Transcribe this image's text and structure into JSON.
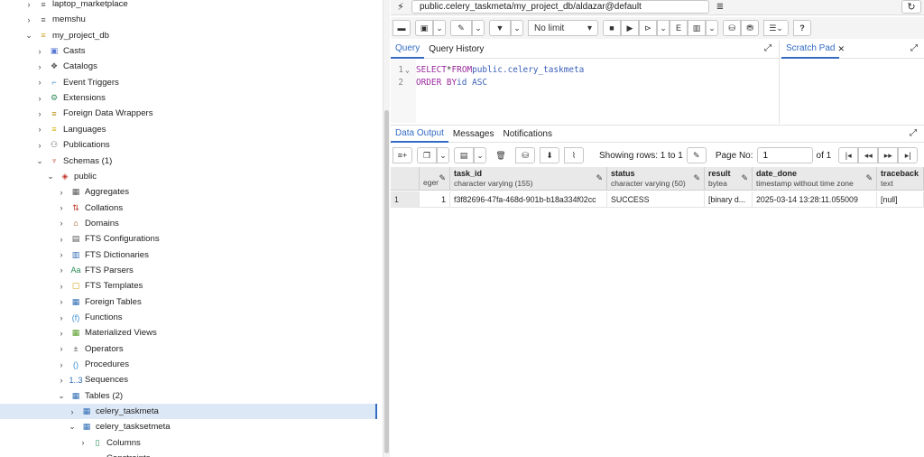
{
  "tree": {
    "nodes": [
      {
        "label": "laptop_marketplace",
        "chev": "›",
        "icon": "database-icon",
        "glyph": "≡",
        "color": "#555",
        "level": 0
      },
      {
        "label": "memshu",
        "chev": "›",
        "icon": "database-icon",
        "glyph": "≡",
        "color": "#555",
        "level": 0
      },
      {
        "label": "my_project_db",
        "chev": "⌄",
        "icon": "database-icon",
        "glyph": "≡",
        "color": "#c9a227",
        "level": 0
      },
      {
        "label": "Casts",
        "chev": "›",
        "icon": "casts-icon",
        "glyph": "▣",
        "color": "#5b7bd5",
        "level": 1
      },
      {
        "label": "Catalogs",
        "chev": "›",
        "icon": "catalogs-icon",
        "glyph": "❖",
        "color": "#555",
        "level": 1
      },
      {
        "label": "Event Triggers",
        "chev": "›",
        "icon": "event-triggers-icon",
        "glyph": "⌐",
        "color": "#3a8dd1",
        "level": 1
      },
      {
        "label": "Extensions",
        "chev": "›",
        "icon": "extensions-icon",
        "glyph": "⚙",
        "color": "#2e8b57",
        "level": 1
      },
      {
        "label": "Foreign Data Wrappers",
        "chev": "›",
        "icon": "foreign-data-wrappers-icon",
        "glyph": "≡",
        "color": "#b8860b",
        "level": 1
      },
      {
        "label": "Languages",
        "chev": "›",
        "icon": "languages-icon",
        "glyph": "≡",
        "color": "#d4b106",
        "level": 1
      },
      {
        "label": "Publications",
        "chev": "›",
        "icon": "publications-icon",
        "glyph": "⚇",
        "color": "#666",
        "level": 1
      },
      {
        "label": "Schemas (1)",
        "chev": "⌄",
        "icon": "schemas-icon",
        "glyph": "♆",
        "color": "#c0392b",
        "level": 1
      },
      {
        "label": "public",
        "chev": "⌄",
        "icon": "schema-icon",
        "glyph": "◈",
        "color": "#c0392b",
        "level": 2
      },
      {
        "label": "Aggregates",
        "chev": "›",
        "icon": "aggregates-icon",
        "glyph": "▦",
        "color": "#555",
        "level": 3
      },
      {
        "label": "Collations",
        "chev": "›",
        "icon": "collations-icon",
        "glyph": "⇅",
        "color": "#c0392b",
        "level": 3
      },
      {
        "label": "Domains",
        "chev": "›",
        "icon": "domains-icon",
        "glyph": "⌂",
        "color": "#8b4513",
        "level": 3
      },
      {
        "label": "FTS Configurations",
        "chev": "›",
        "icon": "fts-configurations-icon",
        "glyph": "▤",
        "color": "#555",
        "level": 3
      },
      {
        "label": "FTS Dictionaries",
        "chev": "›",
        "icon": "fts-dictionaries-icon",
        "glyph": "▥",
        "color": "#2e6db4",
        "level": 3
      },
      {
        "label": "FTS Parsers",
        "chev": "›",
        "icon": "fts-parsers-icon",
        "glyph": "Aa",
        "color": "#2e8b57",
        "level": 3
      },
      {
        "label": "FTS Templates",
        "chev": "›",
        "icon": "fts-templates-icon",
        "glyph": "▢",
        "color": "#d4a017",
        "level": 3
      },
      {
        "label": "Foreign Tables",
        "chev": "›",
        "icon": "foreign-tables-icon",
        "glyph": "▦",
        "color": "#2e6db4",
        "level": 3
      },
      {
        "label": "Functions",
        "chev": "›",
        "icon": "functions-icon",
        "glyph": "(f)",
        "color": "#3a8dd1",
        "level": 3
      },
      {
        "label": "Materialized Views",
        "chev": "›",
        "icon": "materialized-views-icon",
        "glyph": "▦",
        "color": "#5aa02c",
        "level": 3
      },
      {
        "label": "Operators",
        "chev": "›",
        "icon": "operators-icon",
        "glyph": "±",
        "color": "#555",
        "level": 3
      },
      {
        "label": "Procedures",
        "chev": "›",
        "icon": "procedures-icon",
        "glyph": "()",
        "color": "#3a8dd1",
        "level": 3
      },
      {
        "label": "Sequences",
        "chev": "›",
        "icon": "sequences-icon",
        "glyph": "1..3",
        "color": "#2e6db4",
        "level": 3
      },
      {
        "label": "Tables (2)",
        "chev": "⌄",
        "icon": "tables-icon",
        "glyph": "▦",
        "color": "#2e6db4",
        "level": 3
      },
      {
        "label": "celery_taskmeta",
        "chev": "›",
        "icon": "table-icon",
        "glyph": "▦",
        "color": "#2e6db4",
        "level": 4,
        "selected": true
      },
      {
        "label": "celery_tasksetmeta",
        "chev": "⌄",
        "icon": "table-icon",
        "glyph": "▦",
        "color": "#2e6db4",
        "level": 4
      },
      {
        "label": "Columns",
        "chev": "›",
        "icon": "columns-icon",
        "glyph": "▯",
        "color": "#2e8b57",
        "level": 5
      },
      {
        "label": "Constraints",
        "chev": "›",
        "icon": "constraints-icon",
        "glyph": "",
        "color": "#555",
        "level": 5
      }
    ]
  },
  "connection": {
    "title": "public.celery_taskmeta/my_project_db/aldazar@default"
  },
  "toolbar": {
    "limit": "No limit"
  },
  "editor": {
    "tab_query": "Query",
    "tab_history": "Query History",
    "lines": [
      {
        "num": "1",
        "kw1": "SELECT",
        "op": " * ",
        "kw2": "FROM",
        "rest": " public.celery_taskmeta"
      },
      {
        "num": "2",
        "kw1": "ORDER BY",
        "op": " ",
        "kw2": "",
        "rest": "id ASC"
      }
    ]
  },
  "scratch": {
    "label": "Scratch Pad",
    "close": "✕"
  },
  "output": {
    "tab_data": "Data Output",
    "tab_messages": "Messages",
    "tab_notifications": "Notifications",
    "showing": "Showing rows: 1 to 1",
    "page_label": "Page No:",
    "page_value": "1",
    "page_of": "of 1"
  },
  "grid": {
    "columns": [
      {
        "name": "",
        "type": "eger",
        "pen": true
      },
      {
        "name": "task_id",
        "type": "character varying (155)",
        "pen": true
      },
      {
        "name": "status",
        "type": "character varying (50)",
        "pen": true
      },
      {
        "name": "result",
        "type": "bytea",
        "pen": true
      },
      {
        "name": "date_done",
        "type": "timestamp without time zone",
        "pen": true
      },
      {
        "name": "traceback",
        "type": "text",
        "pen": false
      }
    ],
    "rows": [
      {
        "num": "1",
        "cells": [
          "1",
          "f3f82696-47fa-468d-901b-b18a334f02cc",
          "SUCCESS",
          "[binary d...",
          "2025-03-14 13:28:11.055009",
          "[null]"
        ]
      }
    ]
  }
}
